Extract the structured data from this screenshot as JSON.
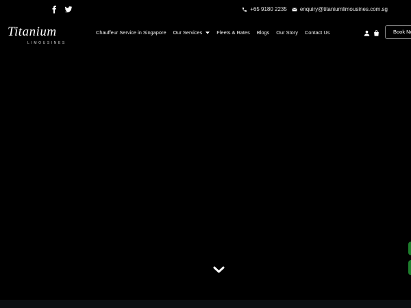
{
  "topbar": {
    "social": [
      {
        "name": "facebook-icon"
      },
      {
        "name": "twitter-icon"
      }
    ],
    "phone": "+65 9180 2235",
    "email": "enquiry@titaniumlimousines.com.sg"
  },
  "brand": {
    "name": "Titanium",
    "tagline": "LIMOUSINES"
  },
  "nav": {
    "items": [
      {
        "label": "Chauffeur Service in Singapore",
        "dropdown": false
      },
      {
        "label": "Our Services",
        "dropdown": true
      },
      {
        "label": "Fleets & Rates",
        "dropdown": false
      },
      {
        "label": "Blogs",
        "dropdown": false
      },
      {
        "label": "Our Story",
        "dropdown": false
      },
      {
        "label": "Contact Us",
        "dropdown": false
      }
    ],
    "book_label": "Book Now"
  },
  "colors": {
    "background": "#000000",
    "text": "#ffffff",
    "side_tab": "#1d7d2c",
    "bottom_strip": "#0c0f12"
  },
  "icons": {
    "phone": "phone-icon",
    "email": "envelope-icon",
    "user": "user-icon",
    "cart": "shopping-bag-icon",
    "scroll": "chevron-down-icon"
  }
}
